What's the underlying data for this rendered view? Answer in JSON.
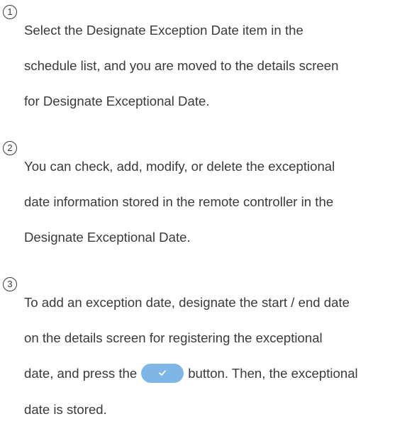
{
  "steps": [
    {
      "number": "1",
      "lines": [
        "Select the Designate Exception Date item in the",
        "schedule list, and you are moved to the details screen",
        "for Designate Exceptional Date."
      ]
    },
    {
      "number": "2",
      "lines": [
        "You can check, add, modify, or delete the exceptional",
        "date information stored in the remote controller in the",
        "Designate Exceptional Date."
      ]
    },
    {
      "number": "3",
      "lines": [
        "To add an exception date, designate the start / end date",
        "on the details screen for registering the exceptional"
      ],
      "line3_before": "date, and press the",
      "line3_after": "button. Then, the exceptional",
      "line4": "date is stored."
    }
  ],
  "colors": {
    "text": "#3a3a3a",
    "button_fill": "#7fb6e8",
    "button_icon": "#ffffff"
  },
  "icons": {
    "confirm_button_icon": "checkmark-icon"
  }
}
